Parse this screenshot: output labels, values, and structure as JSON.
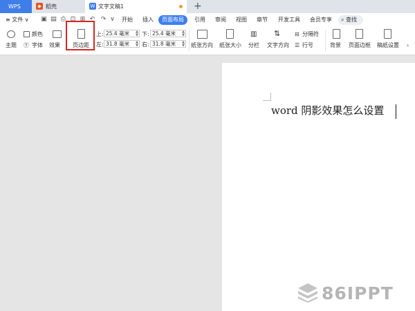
{
  "tabs": {
    "wps": "WPS",
    "shell": "稻壳",
    "doc": "文字文稿1",
    "new_tab": "+"
  },
  "menu": {
    "file": "≡ 文件 ∨",
    "items": [
      "开始",
      "插入",
      "页面布局",
      "引用",
      "审阅",
      "视图",
      "章节",
      "开发工具",
      "会员专享"
    ],
    "active": "页面布局",
    "search": "查找"
  },
  "ribbon": {
    "theme": "主题",
    "color": "颜色",
    "font": "字体",
    "effect": "效果",
    "margins": "页边距",
    "top_label": "上:",
    "top_value": "25.4 毫米",
    "bottom_label": "下:",
    "bottom_value": "25.4 毫米",
    "left_label": "左:",
    "left_value": "31.8 毫米",
    "right_label": "右:",
    "right_value": "31.8 毫米",
    "orientation": "纸张方向",
    "paper_size": "纸张大小",
    "columns": "分栏",
    "text_direction": "文字方向",
    "separator": "分隔符",
    "line_number": "行号",
    "background": "背景",
    "page_border": "页面边框",
    "manuscript": "稿纸设置"
  },
  "document": {
    "text": "word 阴影效果怎么设置"
  },
  "watermark": {
    "text": "86IPPT"
  },
  "colors": {
    "accent": "#3d7ef0",
    "highlight_box": "#d9261c"
  }
}
